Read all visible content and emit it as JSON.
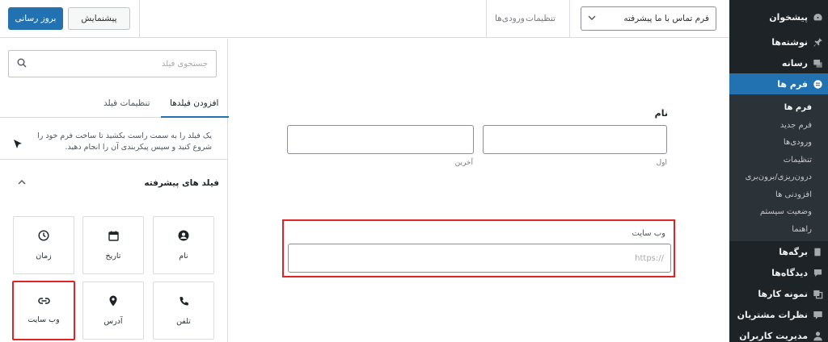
{
  "toolbar": {
    "update_label": "بروز رسانی",
    "preview_label": "پیشنمایش",
    "tab_entries": "ورودی‌ها",
    "tab_settings": "تنظیمات",
    "form_select_value": "فرم تماس با ما پیشرفته"
  },
  "sidebar": {
    "items": [
      {
        "label": "پیشخوان",
        "icon": "dashboard-icon"
      },
      {
        "label": "نوشته‌ها",
        "icon": "pin-icon"
      },
      {
        "label": "رسانه",
        "icon": "media-icon"
      },
      {
        "label": "فرم ها",
        "icon": "forms-icon",
        "active": true
      }
    ],
    "submenu": [
      "فرم ها",
      "فرم جدید",
      "ورودی‌ها",
      "تنظیمات",
      "درون‌ریزی/برون‌بری",
      "افزودنی ها",
      "وضعیت سیستم",
      "راهنما"
    ],
    "items_after": [
      {
        "label": "برگه‌ها",
        "icon": "pages-icon"
      },
      {
        "label": "دیدگاه‌ها",
        "icon": "comments-icon"
      },
      {
        "label": "نمونه کارها",
        "icon": "portfolio-icon"
      },
      {
        "label": "نظرات مشتریان",
        "icon": "testimonials-icon"
      },
      {
        "label": "مدیریت کاربران",
        "icon": "users-icon"
      }
    ]
  },
  "panel": {
    "search_placeholder": "جستجوی فیلد",
    "tab_add_fields": "افزودن فیلدها",
    "tab_field_settings": "تنظیمات فیلد",
    "info_text": "یک فیلد را به سمت راست بکشید تا ساخت فرم خود را شروع کنید و سپس پیکربندی آن را انجام دهید.",
    "section_title": "فیلد های پیشرفته",
    "fields": [
      {
        "label": "نام",
        "icon": "user-icon"
      },
      {
        "label": "تاریخ",
        "icon": "calendar-icon"
      },
      {
        "label": "زمان",
        "icon": "clock-icon"
      },
      {
        "label": "تلفن",
        "icon": "phone-icon"
      },
      {
        "label": "آدرس",
        "icon": "location-pin-icon"
      },
      {
        "label": "وب سایت",
        "icon": "link-icon",
        "highlighted": true
      }
    ]
  },
  "canvas": {
    "name_label": "نام",
    "first_sublabel": "اول",
    "last_sublabel": "آخرین",
    "website_label": "وب سایت",
    "website_placeholder": "https://"
  },
  "colors": {
    "accent": "#2271b1",
    "highlight": "#e02424",
    "sidebar_bg": "#1d2327"
  }
}
